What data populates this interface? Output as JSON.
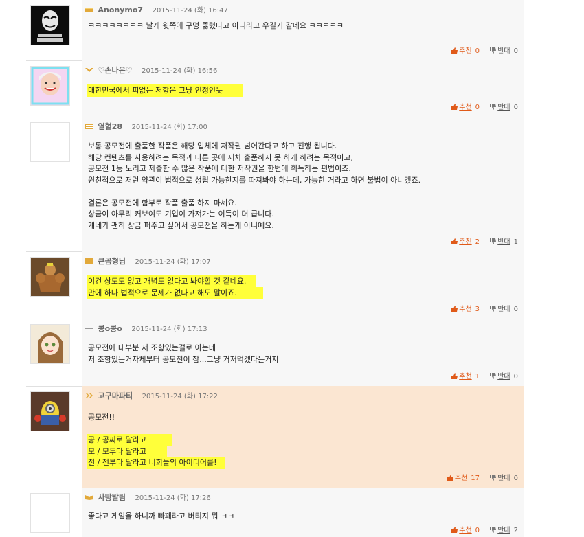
{
  "vote_labels": {
    "up": "추천",
    "down": "반대"
  },
  "colors": {
    "highlight": "#ffff3a",
    "up": "#e05a19",
    "accent_bg": "#fbe6d2"
  },
  "comments": [
    {
      "nick": "Anonymo7",
      "date": "2015-11-24 (화) 16:47",
      "lines": [
        "ㅋㅋㅋㅋㅋㅋㅋㅋ 날개 윗쪽에 구멍 뚫렸다고 아니라고 우길거 같네요 ㅋㅋㅋㅋㅋ"
      ],
      "up": "0",
      "down": "0"
    },
    {
      "nick": "♡손나은♡",
      "date": "2015-11-24 (화) 16:56",
      "lines": [
        "대한민국에서 피없는 저항은 그냥 인정인듯"
      ],
      "up": "0",
      "down": "0"
    },
    {
      "nick": "열혈28",
      "date": "2015-11-24 (화) 17:00",
      "lines": [
        "보통 공모전에 출품한 작품은 해당 업체에 저작권 넘어간다고 하고 진행 됩니다.",
        "해당 컨텐츠를 사용하려는 목적과 다른 곳에 재차 출품하지 못 하게 하려는 목적이고,",
        "공모전 1등 노리고 제출한 수 많은 작품에 대한 저작권을 한번에 획득하는 편법이죠.",
        "원천적으로 저런 약관이 법적으로 성립 가능한지를 따져봐야 하는데, 가능한 거라고 하면 불법이 아니겠죠.",
        "",
        "결론은 공모전에 함부로 작품 출품 하지 마세요.",
        "상금이 아무리 커보여도 기업이 가져가는 이득이 더 큽니다.",
        "걔네가 괜히 상금 퍼주고 싶어서 공모전을 하는게 아니예요."
      ],
      "up": "2",
      "down": "1"
    },
    {
      "nick": "큰곰형님",
      "date": "2015-11-24 (화) 17:07",
      "lines": [
        "이건 상도도 없고 개념도 없다고 봐야할 것 같네요.",
        "만에 하나 법적으로 문제가 없다고 해도 말이죠."
      ],
      "up": "3",
      "down": "0"
    },
    {
      "nick": "콩o콩o",
      "date": "2015-11-24 (화) 17:13",
      "lines": [
        "공모전에 대부분 저 조항있는걸로 아는데",
        "저 조항있는거자체부터 공모전이 참...그냥 거저먹겠다는거지"
      ],
      "up": "1",
      "down": "0"
    },
    {
      "nick": "고구마파티",
      "date": "2015-11-24 (화) 17:22",
      "lines": [
        "공모전!!",
        "",
        "공 / 공짜로 달라고",
        "모 / 모두다 달라고",
        "전 / 전부다 달라고 너희들의 아이디어를!"
      ],
      "up": "17",
      "down": "0"
    },
    {
      "nick": "사탕발림",
      "date": "2015-11-24 (화) 17:26",
      "lines": [
        "좋다고 게임을 하니까 빠꽤라고 버티지 뭐 ㅋㅋ"
      ],
      "up": "0",
      "down": "2"
    }
  ]
}
